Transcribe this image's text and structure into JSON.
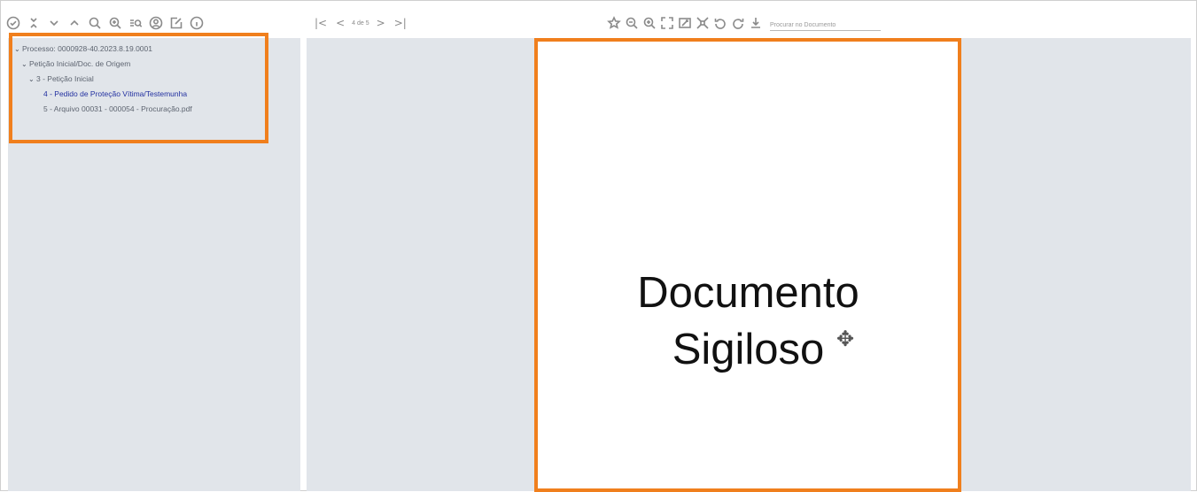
{
  "toolbar_left": {
    "icons": [
      "check-circle-icon",
      "collapse-icon",
      "chevron-down-icon",
      "chevron-up-icon",
      "search-icon",
      "zoom-in-icon",
      "list-search-icon",
      "user-circle-icon",
      "edit-icon",
      "info-icon"
    ]
  },
  "pager": {
    "first": "|<",
    "prev": "<",
    "page_text": "4 de 5",
    "next": ">",
    "last": ">|"
  },
  "toolbar_doc": {
    "icons": [
      "star-icon",
      "zoom-out-icon",
      "zoom-in-icon",
      "fullscreen-icon",
      "fit-width-icon",
      "fit-page-icon",
      "rotate-left-icon",
      "rotate-right-icon",
      "download-icon"
    ],
    "search_placeholder": "Procurar no Documento"
  },
  "tree": {
    "root": "Processo: 0000928-40.2023.8.19.0001",
    "group": "Petição Inicial/Doc. de Origem",
    "subgroup": "3 - Petição Inicial",
    "item4": "4 - Pedido de Proteção Vítima/Testemunha",
    "item5": "5 - Arquivo 00031 - 000054 - Procuração.pdf"
  },
  "document": {
    "line1": "Documento",
    "line2": "Sigiloso"
  },
  "colors": {
    "highlight": "#f07f1d",
    "panel_bg": "#e1e5ea",
    "active_link": "#2230a0"
  }
}
